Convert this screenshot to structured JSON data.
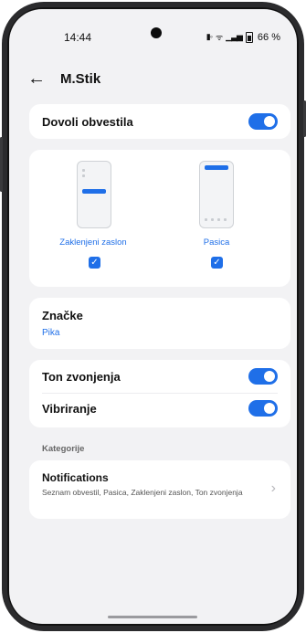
{
  "status": {
    "time": "14:44",
    "battery": "66 %"
  },
  "header": {
    "title": "M.Stik"
  },
  "allow_notifications": {
    "label": "Dovoli obvestila",
    "enabled": true
  },
  "styles": [
    {
      "label": "Zaklenjeni zaslon",
      "checked": true
    },
    {
      "label": "Pasica",
      "checked": true
    }
  ],
  "badges": {
    "label": "Značke",
    "value": "Pika"
  },
  "sound": {
    "ringtone_label": "Ton zvonjenja",
    "ringtone_on": true,
    "vibration_label": "Vibriranje",
    "vibration_on": true
  },
  "categories": {
    "header": "Kategorije",
    "items": [
      {
        "title": "Notifications",
        "subtitle": "Seznam obvestil, Pasica, Zaklenjeni zaslon, Ton zvonjenja"
      }
    ]
  },
  "colors": {
    "accent": "#1f6fe8",
    "background": "#f2f2f4"
  }
}
